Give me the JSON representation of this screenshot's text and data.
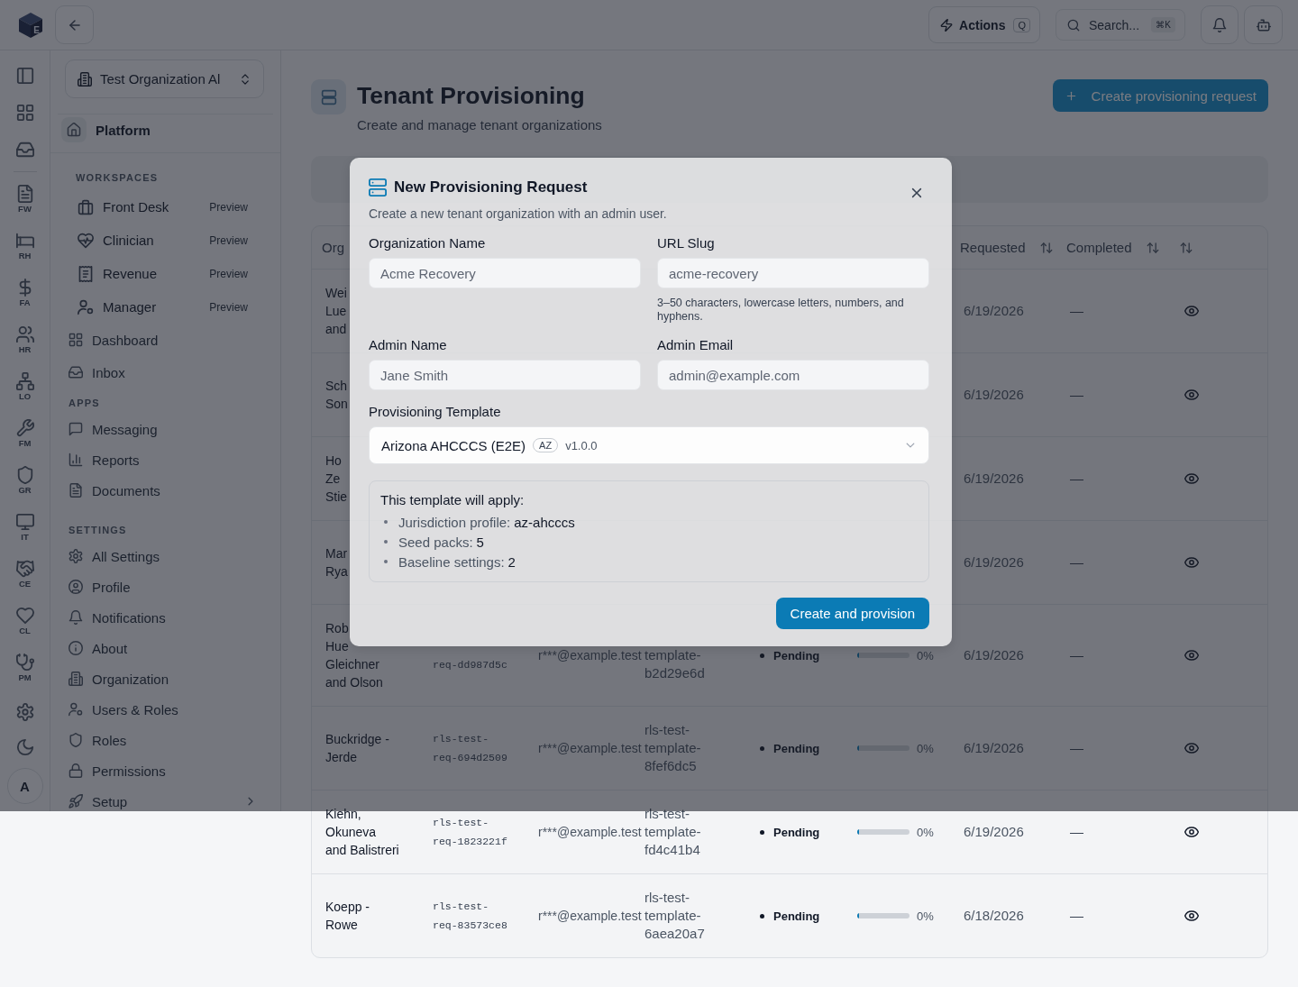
{
  "topbar": {
    "logo_letter": "E",
    "actions": {
      "label": "Actions",
      "shortcut": "Q"
    },
    "search": {
      "placeholder": "Search...",
      "shortcut": "⌘K"
    }
  },
  "rail": {
    "apps": [
      {
        "label": "FW"
      },
      {
        "label": "RH"
      },
      {
        "label": "FA"
      },
      {
        "label": "HR"
      },
      {
        "label": "LO"
      },
      {
        "label": "FM"
      },
      {
        "label": "GR"
      },
      {
        "label": "IT"
      },
      {
        "label": "CE"
      },
      {
        "label": "CL"
      },
      {
        "label": "PM"
      }
    ],
    "avatar": "A"
  },
  "sidebar": {
    "organization": "Test Organization Al",
    "platform": "Platform",
    "sections": [
      {
        "title": "WORKSPACES",
        "items": [
          {
            "kind": "workspace",
            "label": "Front Desk",
            "badge": "Preview"
          },
          {
            "kind": "workspace",
            "label": "Clinician",
            "badge": "Preview"
          },
          {
            "kind": "workspace",
            "label": "Revenue",
            "badge": "Preview"
          },
          {
            "kind": "workspace",
            "label": "Manager",
            "badge": "Preview"
          },
          {
            "kind": "link",
            "label": "Dashboard"
          },
          {
            "kind": "link",
            "label": "Inbox"
          }
        ]
      },
      {
        "title": "APPS",
        "items": [
          {
            "kind": "link",
            "label": "Messaging"
          },
          {
            "kind": "link",
            "label": "Reports"
          },
          {
            "kind": "link",
            "label": "Documents"
          }
        ]
      },
      {
        "title": "SETTINGS",
        "items": [
          {
            "kind": "link",
            "label": "All Settings"
          },
          {
            "kind": "link",
            "label": "Profile"
          },
          {
            "kind": "link",
            "label": "Notifications"
          },
          {
            "kind": "link",
            "label": "About"
          },
          {
            "kind": "link",
            "label": "Organization"
          },
          {
            "kind": "link",
            "label": "Users & Roles"
          },
          {
            "kind": "link",
            "label": "Roles"
          },
          {
            "kind": "link",
            "label": "Permissions"
          },
          {
            "kind": "group",
            "label": "Setup",
            "expanded": false
          }
        ]
      }
    ]
  },
  "page_header": {
    "title": "Tenant Provisioning",
    "subtitle": "Create and manage tenant organizations",
    "create_button": "Create provisioning request"
  },
  "table": {
    "columns": [
      {
        "label": "Org"
      },
      {
        "label": "Requested"
      },
      {
        "label": "Completed"
      }
    ],
    "rows": [
      {
        "organization_lines": [
          "Wei",
          "Lue",
          "and"
        ],
        "requested": "6/19/2026",
        "completed": "—"
      },
      {
        "organization_lines": [
          "Sch",
          "Son"
        ],
        "requested": "6/19/2026",
        "completed": "—"
      },
      {
        "organization_lines": [
          "Ho",
          "Ze",
          "Stie"
        ],
        "requested": "6/19/2026",
        "completed": "—"
      },
      {
        "organization_lines": [
          "Mar",
          "Rya"
        ],
        "requested": "6/19/2026",
        "completed": "—"
      },
      {
        "organization_lines": [
          "Rob",
          "Hue",
          "Gleichner and Olson"
        ],
        "request_id_tail": "req-dd987d5c",
        "admin_email": "r***@example.test",
        "template_tail": "template-b2d29e6d",
        "status": "Pending",
        "progress": {
          "level": 0,
          "reading": "0%"
        },
        "requested": "6/19/2026",
        "completed": "—"
      },
      {
        "organization": "Buckridge - Jerde",
        "request_id": "rls-test-req-694d2509",
        "admin_email": "r***@example.test",
        "template": "rls-test-template-8fef6dc5",
        "status": "Pending",
        "progress": {
          "level": 0,
          "reading": "0%"
        },
        "requested": "6/19/2026",
        "completed": "—"
      },
      {
        "organization": "Kiehn, Okuneva and Balistreri",
        "request_id": "rls-test-req-1823221f",
        "admin_email": "r***@example.test",
        "template": "rls-test-template-fd4c41b4",
        "status": "Pending",
        "progress": {
          "level": 0,
          "reading": "0%"
        },
        "requested": "6/19/2026",
        "completed": "—"
      },
      {
        "organization": "Koepp - Rowe",
        "request_id": "rls-test-req-83573ce8",
        "admin_email": "r***@example.test",
        "template": "rls-test-template-6aea20a7",
        "status": "Pending",
        "progress": {
          "level": 0,
          "reading": "0%"
        },
        "requested": "6/18/2026",
        "completed": "—"
      }
    ]
  },
  "modal": {
    "title": "New Provisioning Request",
    "subtitle": "Create a new tenant organization with an admin user.",
    "fields": [
      {
        "label": "Organization Name",
        "placeholder": "Acme Recovery"
      },
      {
        "label": "URL Slug",
        "placeholder": "acme-recovery",
        "hint": "3–50 characters, lowercase letters, numbers, and hyphens."
      },
      {
        "label": "Admin Name",
        "placeholder": "Jane Smith"
      },
      {
        "label": "Admin Email",
        "placeholder": "admin@example.com"
      }
    ],
    "template_select": {
      "label": "Provisioning Template",
      "value": "Arizona AHCCCS (E2E)",
      "badge": "AZ",
      "version": "v1.0.0"
    },
    "template_summary": {
      "title": "This template will apply:",
      "items": [
        {
          "label": "Jurisdiction profile:",
          "value": "az-ahcccs"
        },
        {
          "label": "Seed packs:",
          "value": "5"
        },
        {
          "label": "Baseline settings:",
          "value": "2"
        }
      ]
    },
    "submit_button": "Create and provision"
  }
}
